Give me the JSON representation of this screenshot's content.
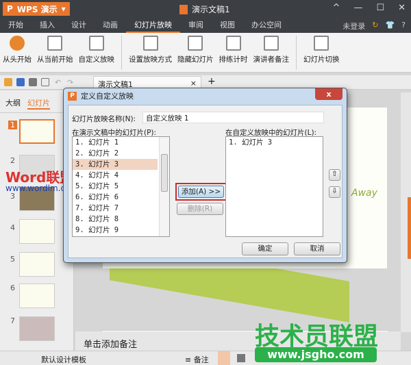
{
  "app": {
    "name": "WPS 演示",
    "doc_title": "演示文稿1",
    "window_controls": [
      "^",
      "—",
      "☐",
      "✕"
    ]
  },
  "menu_tabs": [
    "开始",
    "插入",
    "设计",
    "动画",
    "幻灯片放映",
    "审阅",
    "视图",
    "办公空间"
  ],
  "active_tab": "幻灯片放映",
  "account": {
    "login": "未登录",
    "help": "?"
  },
  "ribbon": [
    "从头开始",
    "从当前开始",
    "自定义放映",
    "设置放映方式",
    "隐藏幻灯片",
    "排练计时",
    "演讲者备注",
    "幻灯片切换"
  ],
  "doc_tab": {
    "label": "演示文稿1",
    "close": "×",
    "add": "+"
  },
  "left_panel": {
    "tabs": [
      "大纲",
      "幻灯片"
    ],
    "slide_numbers": [
      "1",
      "2",
      "3",
      "4",
      "5",
      "6",
      "7"
    ]
  },
  "slide": {
    "text": "Away"
  },
  "notes_placeholder": "单击添加备注",
  "status": {
    "template": "默认设计模板",
    "notes": "备注"
  },
  "dialog": {
    "title": "定义自定义放映",
    "close": "x",
    "name_label": "幻灯片放映名称(N):",
    "name_value": "自定义放映 1",
    "left_label": "在演示文稿中的幻灯片(P):",
    "left_items": [
      "1. 幻灯片 1",
      "2. 幻灯片 2",
      "3. 幻灯片 3",
      "4. 幻灯片 4",
      "5. 幻灯片 5",
      "6. 幻灯片 6",
      "7. 幻灯片 7",
      "8. 幻灯片 8",
      "9. 幻灯片 9"
    ],
    "selected_index": 2,
    "right_label": "在自定义放映中的幻灯片(L):",
    "right_items": [
      "1. 幻灯片 3"
    ],
    "add": "添加(A) >>",
    "remove": "删除(R)",
    "up": "⇧",
    "down": "⇩",
    "ok": "确定",
    "cancel": "取消"
  },
  "watermarks": {
    "w1": "Word联盟",
    "w1_url": "www.wordlm.com",
    "w2": "技术员联盟",
    "w2_url": "www.jsgho.com"
  }
}
